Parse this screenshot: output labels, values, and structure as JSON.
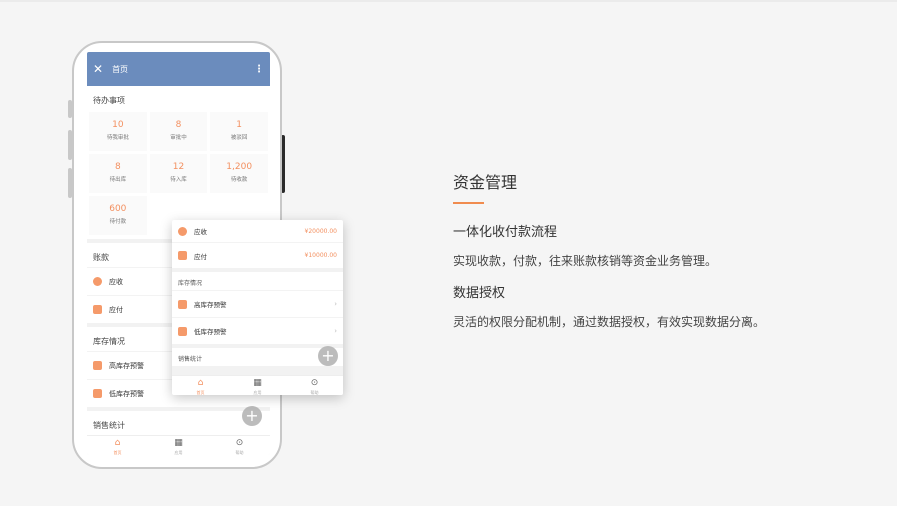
{
  "phone": {
    "appbar": {
      "title": "首页"
    },
    "todo": {
      "title": "待办事项",
      "items": [
        {
          "value": "10",
          "label": "待我审批"
        },
        {
          "value": "8",
          "label": "审批中"
        },
        {
          "value": "1",
          "label": "被驳回"
        },
        {
          "value": "8",
          "label": "待出库"
        },
        {
          "value": "12",
          "label": "待入库"
        },
        {
          "value": "1,200",
          "label": "待收款"
        },
        {
          "value": "600",
          "label": "待付款"
        }
      ]
    },
    "accounts": {
      "title": "账款",
      "receivable": "应收",
      "payable": "应付"
    },
    "inventory": {
      "title": "库存情况",
      "high": "高库存预警",
      "low": "低库存预警"
    },
    "sales": {
      "title": "销售统计"
    },
    "tabs": [
      "首页",
      "应用",
      "帮助"
    ]
  },
  "card": {
    "receivable": {
      "label": "应收",
      "amount": "¥20000.00"
    },
    "payable": {
      "label": "应付",
      "amount": "¥10000.00"
    },
    "inventory": {
      "title": "库存情况",
      "high": "高库存预警",
      "low": "低库存预警"
    },
    "sales": {
      "title": "销售统计"
    },
    "tabs": [
      "首页",
      "应用",
      "帮助"
    ]
  },
  "feature": {
    "title": "资金管理",
    "sub1": "一体化收付款流程",
    "desc1": "实现收款，付款，往来账款核销等资金业务管理。",
    "sub2": "数据授权",
    "desc2": "灵活的权限分配机制，通过数据授权，有效实现数据分离。"
  },
  "colors": {
    "accent": "#f08b4e",
    "appbar": "#6b8cbd"
  }
}
